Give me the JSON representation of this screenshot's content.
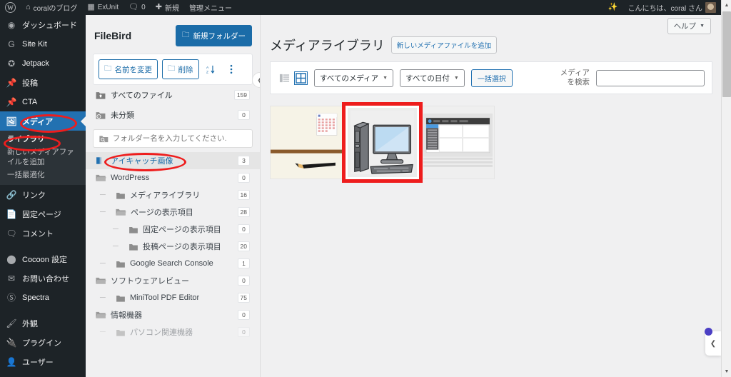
{
  "adminbar": {
    "logo_icon": "wordpress-logo-icon",
    "site": {
      "icon": "home-icon",
      "label": "coralのブログ"
    },
    "exunit": {
      "icon": "plugin-icon",
      "label": "ExUnit"
    },
    "comments": {
      "icon": "comment-icon",
      "count": "0"
    },
    "new": {
      "icon": "plus-icon",
      "label": "新規"
    },
    "admin_menu_label": "管理メニュー",
    "sparkle_icon": "sparkle-icon",
    "greeting": "こんにちは、coral さん",
    "avatar": "user-avatar"
  },
  "adminmenu": {
    "items": [
      {
        "icon": "dashboard-icon",
        "label": "ダッシュボード",
        "glyph": "◉"
      },
      {
        "icon": "site-kit-icon",
        "label": "Site Kit",
        "glyph": "G"
      },
      {
        "icon": "jetpack-icon",
        "label": "Jetpack",
        "glyph": "✪"
      },
      {
        "icon": "posts-pin-icon",
        "label": "投稿",
        "glyph": "📌"
      },
      {
        "icon": "cta-pin-icon",
        "label": "CTA",
        "glyph": "📌"
      },
      {
        "icon": "media-icon",
        "label": "メディア",
        "glyph": "🖼",
        "current": true
      },
      {
        "icon": "link-icon",
        "label": "リンク",
        "glyph": "🔗"
      },
      {
        "icon": "pages-icon",
        "label": "固定ページ",
        "glyph": "📄"
      },
      {
        "icon": "comments-icon",
        "label": "コメント",
        "glyph": "💬"
      },
      {
        "icon": "cocoon-icon",
        "label": "Cocoon 設定",
        "glyph": "⬤"
      },
      {
        "icon": "contact-mail-icon",
        "label": "お問い合わせ",
        "glyph": "✉"
      },
      {
        "icon": "spectra-icon",
        "label": "Spectra",
        "glyph": "Ⓢ"
      },
      {
        "icon": "appearance-icon",
        "label": "外観",
        "glyph": "🖌"
      },
      {
        "icon": "plugins-icon",
        "label": "プラグイン",
        "glyph": "🔌"
      },
      {
        "icon": "users-icon",
        "label": "ユーザー",
        "glyph": "👤"
      }
    ],
    "media_submenu": [
      {
        "label": "ライブラリ",
        "current": true
      },
      {
        "label": "新しいメディアファイルを追加",
        "current": false
      },
      {
        "label": "一括最適化",
        "current": false
      }
    ]
  },
  "filebird": {
    "title": "FileBird",
    "new_folder_button": "新規フォルダー",
    "new_folder_icon": "folder-plus-icon",
    "toolbar": {
      "rename_label": "名前を変更",
      "rename_icon": "folder-edit-icon",
      "delete_label": "削除",
      "delete_icon": "folder-delete-icon",
      "sort_icon": "sort-az-icon",
      "more_icon": "three-dots-vertical-icon"
    },
    "roots": [
      {
        "icon": "folder-home-icon",
        "label": "すべてのファイル",
        "count": "159"
      },
      {
        "icon": "folder-uncategorized-icon",
        "label": "未分類",
        "count": "0"
      }
    ],
    "search_placeholder": "フォルダー名を入力してください.",
    "search_icon": "folder-search-icon",
    "search_value": "",
    "tree": [
      {
        "label": "アイキャッチ画像",
        "count": "3",
        "depth": 0,
        "selected": true,
        "icon": "folder-open-blue-icon"
      },
      {
        "label": "WordPress",
        "count": "0",
        "depth": 0,
        "selected": false,
        "icon": "folder-open-icon"
      },
      {
        "label": "メディアライブラリ",
        "count": "16",
        "depth": 1,
        "selected": false,
        "icon": "folder-icon"
      },
      {
        "label": "ページの表示項目",
        "count": "28",
        "depth": 1,
        "selected": false,
        "icon": "folder-open-icon"
      },
      {
        "label": "固定ページの表示項目",
        "count": "0",
        "depth": 2,
        "selected": false,
        "icon": "folder-icon"
      },
      {
        "label": "投稿ページの表示項目",
        "count": "20",
        "depth": 2,
        "selected": false,
        "icon": "folder-icon"
      },
      {
        "label": "Google Search Console",
        "count": "1",
        "depth": 1,
        "selected": false,
        "icon": "folder-icon"
      },
      {
        "label": "ソフトウェアレビュー",
        "count": "0",
        "depth": 0,
        "selected": false,
        "icon": "folder-open-icon"
      },
      {
        "label": "MiniTool PDF Editor",
        "count": "75",
        "depth": 1,
        "selected": false,
        "icon": "folder-icon"
      },
      {
        "label": "情報機器",
        "count": "0",
        "depth": 0,
        "selected": false,
        "icon": "folder-open-icon"
      },
      {
        "label": "パソコン関連機器",
        "count": "0",
        "depth": 1,
        "selected": false,
        "icon": "folder-icon"
      }
    ],
    "collapse_icon": "chevron-left-icon"
  },
  "main": {
    "help_button": "ヘルプ",
    "help_icon": "chevron-down-icon",
    "page_title": "メディアライブラリ",
    "add_media_button": "新しいメディアファイルを追加",
    "toolbar": {
      "list_view_icon": "list-view-icon",
      "grid_view_icon": "grid-view-icon",
      "media_filter": "すべてのメディア",
      "date_filter": "すべての日付",
      "bulk_select": "一括選択",
      "chevron_icon": "chevron-down-icon"
    },
    "search": {
      "label_line1": "メディア",
      "label_line2": "を検索",
      "value": "",
      "placeholder": ""
    },
    "items": [
      {
        "name": "desk-calendar-pencil-thumbnail",
        "selected": false
      },
      {
        "name": "desktop-computer-thumbnail",
        "selected": true
      },
      {
        "name": "software-window-screenshot-thumbnail",
        "selected": false
      }
    ],
    "float_collapse_icon": "chevron-left-icon",
    "float_dot": "notification-dot"
  },
  "annotations": {
    "color": "#ee1d1d",
    "marks": [
      {
        "name": "media-menu-circle"
      },
      {
        "name": "library-submenu-circle"
      },
      {
        "name": "featured-image-folder-circle"
      },
      {
        "name": "selected-thumbnail-box"
      }
    ]
  },
  "scrollbar": {
    "up_icon": "caret-up-icon",
    "down_icon": "caret-down-icon"
  }
}
